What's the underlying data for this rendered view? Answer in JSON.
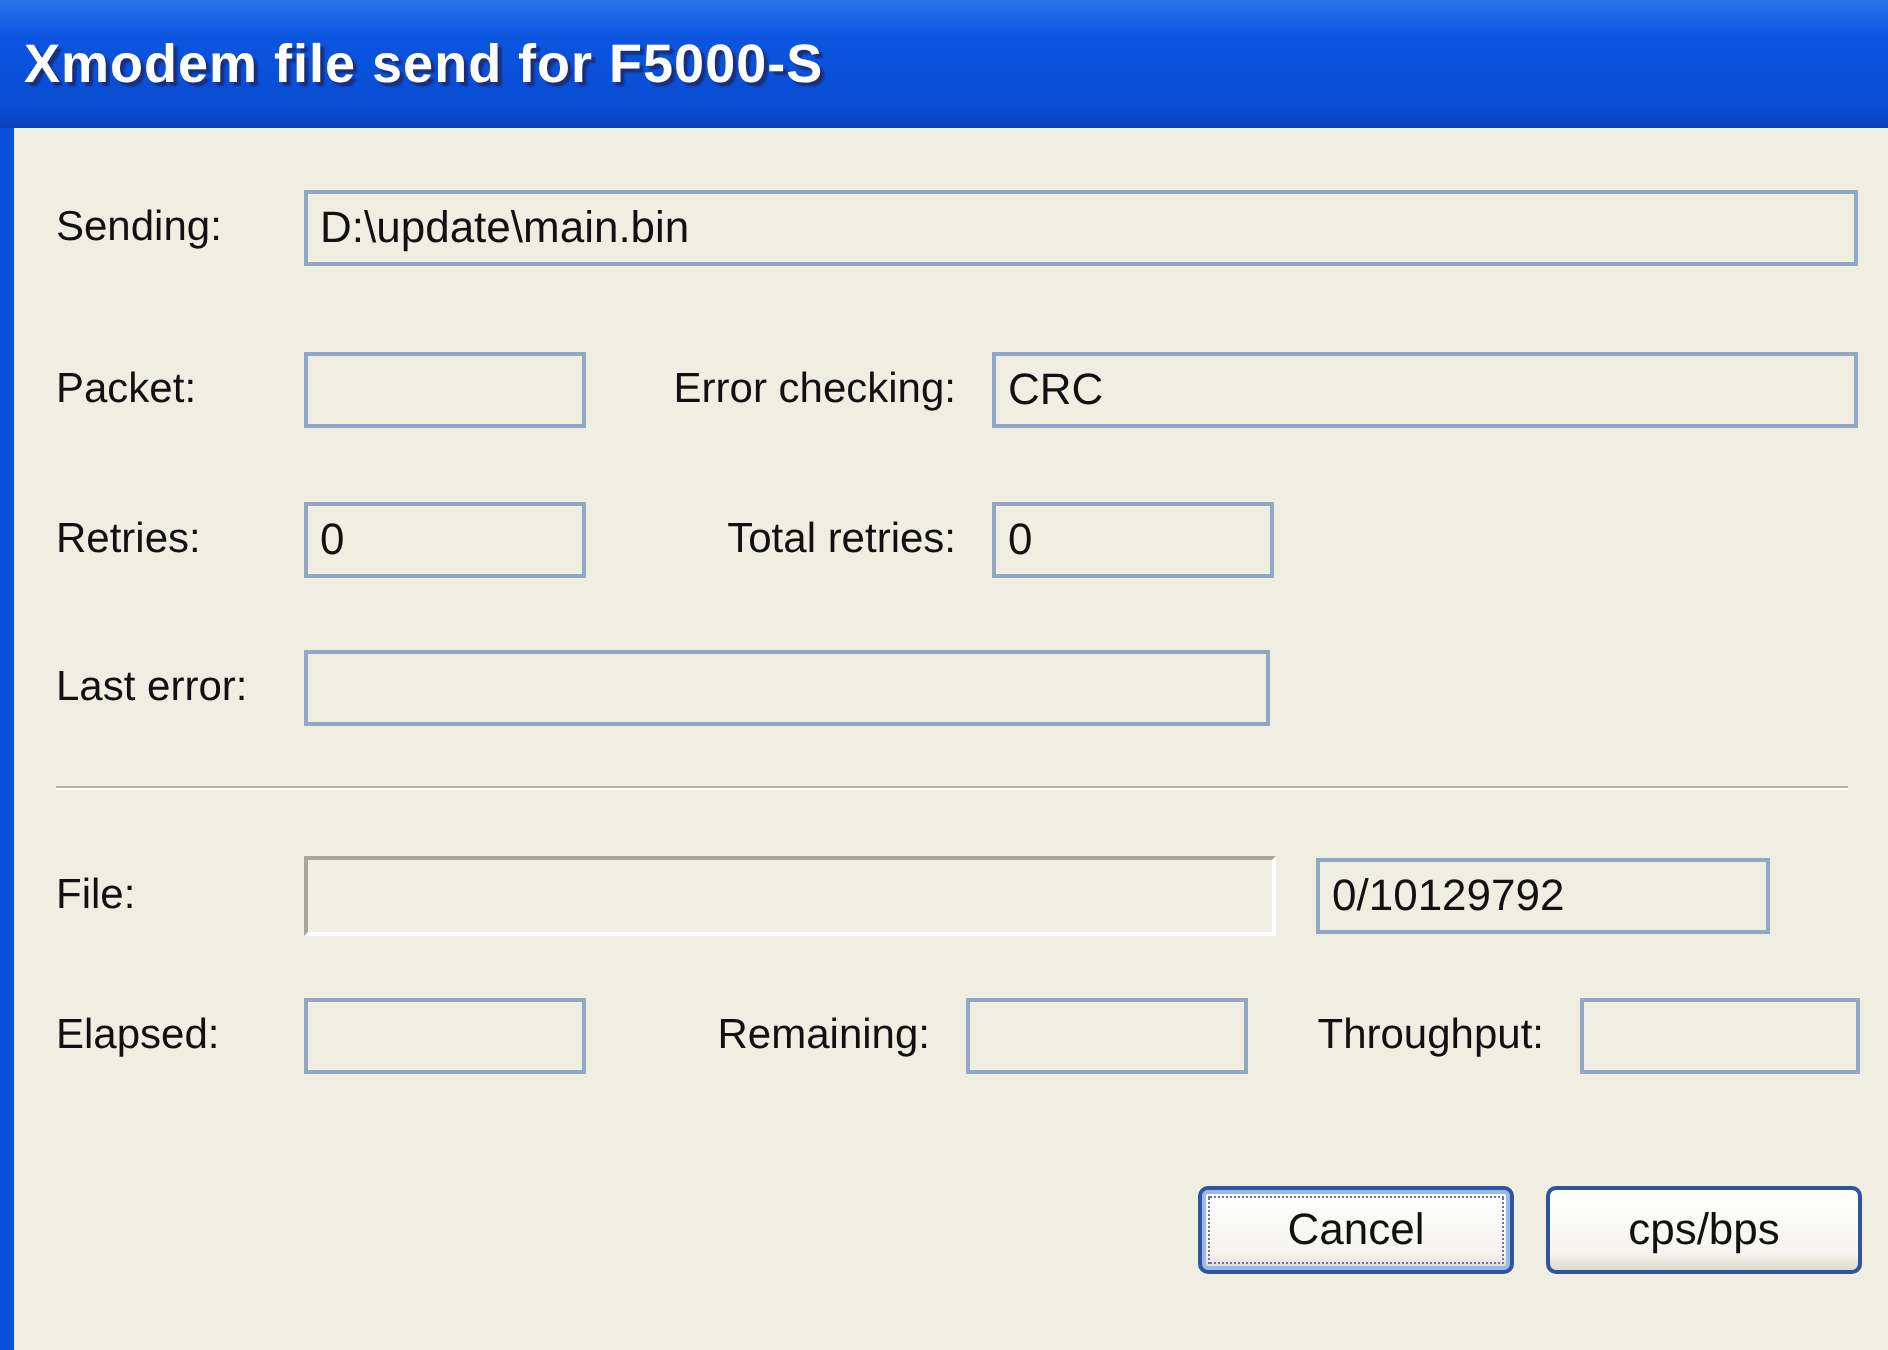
{
  "window": {
    "title": "Xmodem file send for F5000-S"
  },
  "sending": {
    "label": "Sending:",
    "value": "D:\\update\\main.bin"
  },
  "packet": {
    "label": "Packet:"
  },
  "error_checking": {
    "label": "Error checking:",
    "value": "CRC"
  },
  "retries": {
    "label": "Retries:",
    "value": "0"
  },
  "total_retries": {
    "label": "Total retries:",
    "value": "0"
  },
  "last_error": {
    "label": "Last error:"
  },
  "file": {
    "label": "File:",
    "progress": {
      "level": 0
    },
    "count": "0/10129792"
  },
  "elapsed": {
    "label": "Elapsed:"
  },
  "remaining": {
    "label": "Remaining:"
  },
  "throughput": {
    "label": "Throughput:"
  },
  "buttons": [
    {
      "label": "Cancel",
      "focused": true
    },
    {
      "label": "cps/bps",
      "focused": false
    }
  ]
}
